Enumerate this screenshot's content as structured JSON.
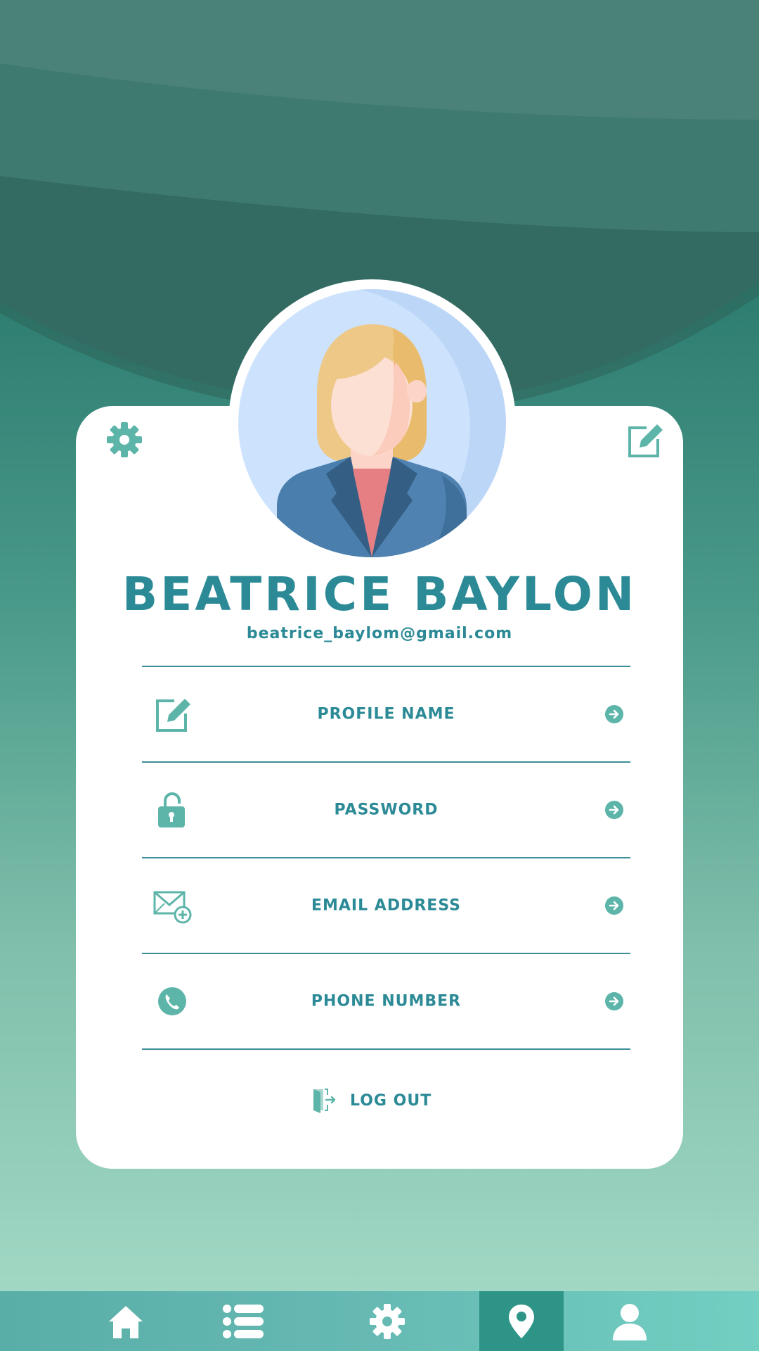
{
  "profile": {
    "name": "BEATRICE BAYLON",
    "email": "beatrice_baylom@gmail.com"
  },
  "menu": [
    {
      "label": "PROFILE NAME",
      "icon": "edit-icon"
    },
    {
      "label": "PASSWORD",
      "icon": "unlock-icon"
    },
    {
      "label": "EMAIL ADDRESS",
      "icon": "mail-add-icon"
    },
    {
      "label": "PHONE NUMBER",
      "icon": "phone-icon"
    }
  ],
  "logout": {
    "label": "LOG OUT",
    "icon": "logout-icon"
  },
  "corner_icons": {
    "left": "gear-icon",
    "right": "edit-icon"
  },
  "bottom_nav": [
    {
      "icon": "home-icon",
      "active": false
    },
    {
      "icon": "list-icon",
      "active": false
    },
    {
      "icon": "gear-icon",
      "active": false
    },
    {
      "icon": "location-pin-icon",
      "active": true
    },
    {
      "icon": "user-icon",
      "active": false
    }
  ],
  "colors": {
    "accent_text": "#2b8a96",
    "icon_teal": "#5db5aa",
    "card": "#ffffff",
    "nav_active": "#2e9488"
  }
}
